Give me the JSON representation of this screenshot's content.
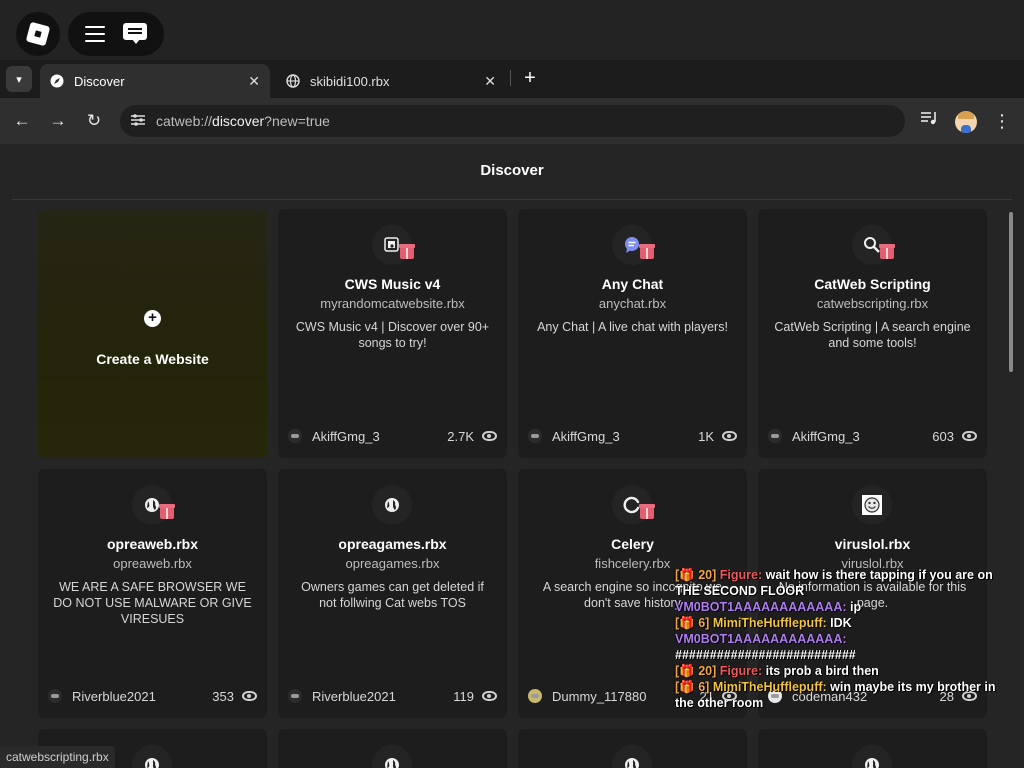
{
  "browser": {
    "tabs": [
      {
        "label": "Discover",
        "icon": "compass-icon",
        "active": true
      },
      {
        "label": "skibidi100.rbx",
        "icon": "globe-icon",
        "active": false
      }
    ],
    "url_prefix": "catweb://",
    "url_main": "discover",
    "url_suffix": "?new=true"
  },
  "page": {
    "title": "Discover",
    "create_label": "Create a Website",
    "status_tip": "catwebscripting.rbx"
  },
  "cards": [
    {
      "title": "CWS Music v4",
      "domain": "myrandomcatwebsite.rbx",
      "desc": "CWS Music v4 | Discover over 90+ songs to try!",
      "author": "AkiffGmg_3",
      "views": "2.7K",
      "icon": "music-icon",
      "gift": true
    },
    {
      "title": "Any Chat",
      "domain": "anychat.rbx",
      "desc": "Any Chat | A live chat with players!",
      "author": "AkiffGmg_3",
      "views": "1K",
      "icon": "chat-icon",
      "gift": true
    },
    {
      "title": "CatWeb Scripting",
      "domain": "catwebscripting.rbx",
      "desc": "CatWeb Scripting | A search engine and some tools!",
      "author": "AkiffGmg_3",
      "views": "603",
      "icon": "search-icon",
      "gift": true
    },
    {
      "title": "opreaweb.rbx",
      "domain": "opreaweb.rbx",
      "desc": "WE ARE A SAFE BROWSER WE DO NOT USE MALWARE OR GIVE VIRESUES",
      "author": "Riverblue2021",
      "views": "353",
      "icon": "globe-icon",
      "gift": true
    },
    {
      "title": "opreagames.rbx",
      "domain": "opreagames.rbx",
      "desc": "Owners games can get deleted if not follwing Cat webs TOS",
      "author": "Riverblue2021",
      "views": "119",
      "icon": "globe-icon",
      "gift": false
    },
    {
      "title": "Celery",
      "domain": "fishcelery.rbx",
      "desc": "A search engine so incognito we don't save history",
      "author": "Dummy_117880",
      "views": "21",
      "icon": "loading-icon",
      "gift": true
    },
    {
      "title": "viruslol.rbx",
      "domain": "viruslol.rbx",
      "desc": "No information is available for this page.",
      "author": "codeman432",
      "views": "28",
      "icon": "smiley-icon",
      "gift": false
    }
  ],
  "chat": [
    {
      "prefix": "[🎁 20]",
      "name": "Figure:",
      "color": "#f05a5a",
      "msg": "wait how is there tapping if you are on THE SECOND FLOOR"
    },
    {
      "prefix": "",
      "name": "VM0BOT1AAAAAAAAAAAA:",
      "color": "#b07cf0",
      "msg": "ip"
    },
    {
      "prefix": "[🎁 6]",
      "name": "MimiTheHufflepuff:",
      "color": "#f2c444",
      "msg": "IDK"
    },
    {
      "prefix": "",
      "name": "VM0BOT1AAAAAAAAAAAA:",
      "color": "#b07cf0",
      "msg": "##########################"
    },
    {
      "prefix": "[🎁 20]",
      "name": "Figure:",
      "color": "#f05a5a",
      "msg": "its prob a bird then"
    },
    {
      "prefix": "[🎁 6]",
      "name": "MimiTheHufflepuff:",
      "color": "#f2c444",
      "msg": "win maybe its my brother in the other room"
    }
  ]
}
